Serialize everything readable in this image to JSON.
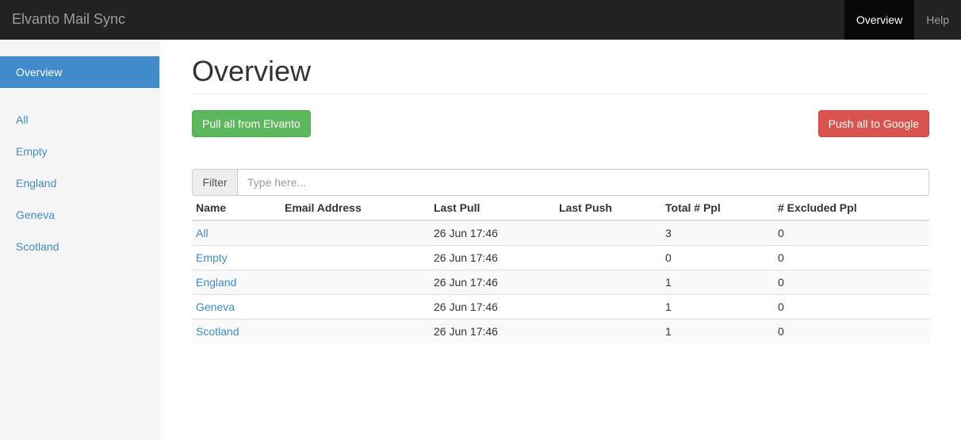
{
  "navbar": {
    "brand": "Elvanto Mail Sync",
    "links": [
      "Overview",
      "Help"
    ]
  },
  "sidebar": {
    "active": "Overview",
    "items": [
      "All",
      "Empty",
      "England",
      "Geneva",
      "Scotland"
    ]
  },
  "main": {
    "title": "Overview",
    "pull_button": "Pull all from Elvanto",
    "push_button": "Push all to Google",
    "filter_label": "Filter",
    "filter_placeholder": "Type here...",
    "filter_value": ""
  },
  "table": {
    "headers": [
      "Name",
      "Email Address",
      "Last Pull",
      "Last Push",
      "Total # Ppl",
      "# Excluded Ppl"
    ],
    "rows": [
      {
        "name": "All",
        "email": "",
        "last_pull": "26 Jun 17:46",
        "last_push": "",
        "total": "3",
        "excluded": "0"
      },
      {
        "name": "Empty",
        "email": "",
        "last_pull": "26 Jun 17:46",
        "last_push": "",
        "total": "0",
        "excluded": "0"
      },
      {
        "name": "England",
        "email": "",
        "last_pull": "26 Jun 17:46",
        "last_push": "",
        "total": "1",
        "excluded": "0"
      },
      {
        "name": "Geneva",
        "email": "",
        "last_pull": "26 Jun 17:46",
        "last_push": "",
        "total": "1",
        "excluded": "0"
      },
      {
        "name": "Scotland",
        "email": "",
        "last_pull": "26 Jun 17:46",
        "last_push": "",
        "total": "1",
        "excluded": "0"
      }
    ]
  },
  "colors": {
    "navbar_bg": "#222222",
    "primary": "#428bca",
    "success": "#5cb85c",
    "danger": "#d9534f"
  }
}
